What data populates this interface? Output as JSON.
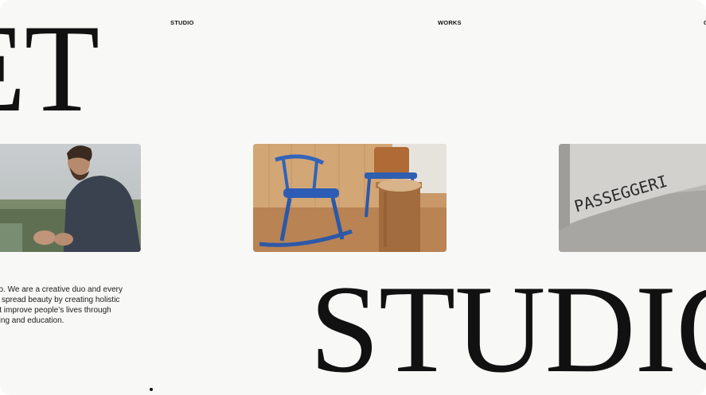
{
  "hero": {
    "text": "ET"
  },
  "nav": {
    "studio": "STUDIO",
    "works": "WORKS",
    "contact": "C"
  },
  "cards": {
    "portrait": {
      "name": "portrait-photo"
    },
    "chairs": {
      "name": "chairs-photo"
    },
    "sign": {
      "sign_text": "PASSEGGERI"
    }
  },
  "intro": {
    "lines": [
      "T Studio. We are a creative duo and every",
      "work to spread beauty by creating holistic",
      "ces that improve people’s lives through",
      "opywriting and education."
    ]
  },
  "footer": {
    "text": "STUDIO"
  },
  "colors": {
    "background": "#f8f8f7",
    "text": "#111111"
  }
}
